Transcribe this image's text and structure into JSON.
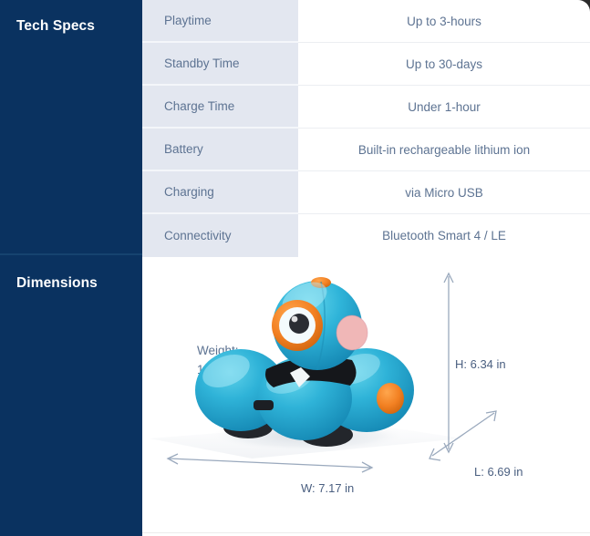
{
  "sections": [
    {
      "title": "Tech Specs"
    },
    {
      "title": "Dimensions"
    }
  ],
  "specs": [
    {
      "label": "Playtime",
      "value": "Up to 3-hours"
    },
    {
      "label": "Standby Time",
      "value": "Up to 30-days"
    },
    {
      "label": "Charge Time",
      "value": "Under 1-hour"
    },
    {
      "label": "Battery",
      "value": "Built-in rechargeable lithium ion"
    },
    {
      "label": "Charging",
      "value": "via Micro USB"
    },
    {
      "label": "Connectivity",
      "value": "Bluetooth Smart 4 / LE"
    }
  ],
  "dimensions": {
    "weight_label": "Weight:",
    "weight_value": "1.76 lbs",
    "height": "H:  6.34 in",
    "length": "L: 6.69 in",
    "width": "W: 7.17 in",
    "product_image_alt": "Dash robot, three-lobed cyan body with orange accents"
  },
  "colors": {
    "sidebar_navy": "#0a3260",
    "label_cell": "#e3e7f0",
    "text_slate": "#5d7392",
    "robot_body": "#29abd4",
    "robot_accent_orange": "#f28022",
    "robot_cheek_pink": "#f0b7b7"
  }
}
